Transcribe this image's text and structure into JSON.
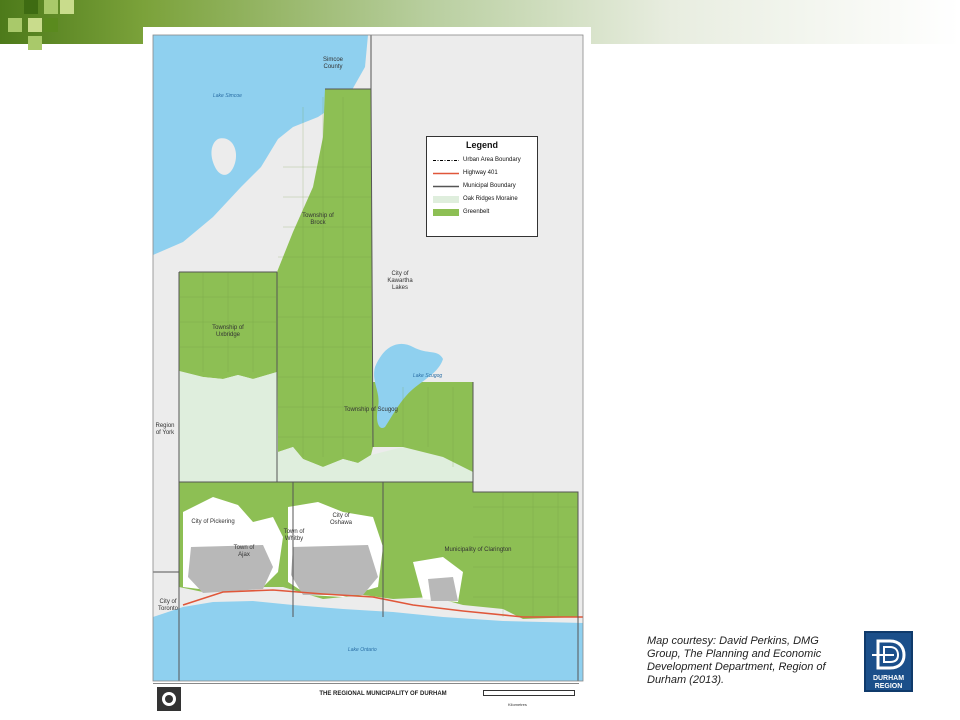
{
  "map": {
    "labels": {
      "simcoe": "Simcoe County",
      "lake_simcoe": "Lake Simcoe",
      "brock": "Township of Brock",
      "kawartha": "City of Kawartha Lakes",
      "uxbridge": "Township of Uxbridge",
      "scugog": "Township of Scugog",
      "lake_scugog": "Lake Scugog",
      "york": "Region of York",
      "pickering": "City of Pickering",
      "ajax": "Town of Ajax",
      "whitby": "Town of Whitby",
      "oshawa": "City of Oshawa",
      "clarington": "Municipality of Clarington",
      "toronto": "City of Toronto",
      "lake_ontario": "Lake Ontario"
    },
    "legend": {
      "title": "Legend",
      "items": [
        {
          "label": "Urban Area Boundary",
          "color": "#000000"
        },
        {
          "label": "Highway 401",
          "color": "#e0573a"
        },
        {
          "label": "Municipal Boundary",
          "color": "#555555"
        },
        {
          "label": "Oak Ridges Moraine",
          "color": "#dfeedd"
        },
        {
          "label": "Greenbelt",
          "color": "#8dbf54"
        }
      ]
    },
    "title_block": {
      "title": "THE REGIONAL MUNICIPALITY OF DURHAM",
      "scale_label": "Kilometres"
    },
    "colors": {
      "water": "#8fd0ef",
      "greenbelt": "#8dbf54",
      "moraine": "#dfeedd",
      "land": "#ececec"
    }
  },
  "caption": "Map courtesy: David Perkins, DMG Group, The Planning and Economic Development Department, Region of Durham (2013).",
  "logo": {
    "line1": "DURHAM",
    "line2": "REGION"
  }
}
